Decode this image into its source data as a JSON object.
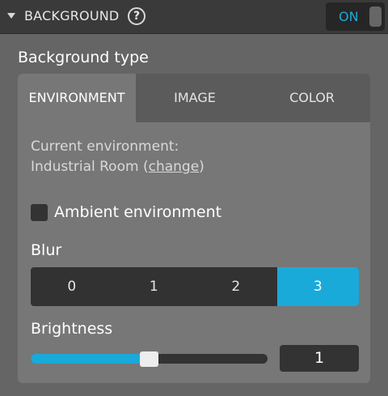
{
  "header": {
    "title": "BACKGROUND",
    "help_glyph": "?",
    "toggle_label": "ON",
    "toggle_on": true
  },
  "section_title": "Background type",
  "tabs": [
    {
      "label": "ENVIRONMENT",
      "active": true
    },
    {
      "label": "IMAGE",
      "active": false
    },
    {
      "label": "COLOR",
      "active": false
    }
  ],
  "environment": {
    "current_label": "Current environment:",
    "name": "Industrial Room",
    "open_paren": " (",
    "change_link": "change",
    "close_paren": ")"
  },
  "ambient": {
    "label": "Ambient environment",
    "checked": false
  },
  "blur": {
    "label": "Blur",
    "options": [
      "0",
      "1",
      "2",
      "3"
    ],
    "selected": "3"
  },
  "brightness": {
    "label": "Brightness",
    "value": "1",
    "slider_fraction": 0.5
  },
  "colors": {
    "accent": "#1aaad9",
    "toggle_text": "#20a8d8",
    "page_bg": "#656565",
    "panel_bg": "#777777",
    "header_bg": "#3a3a3a"
  },
  "icons": {
    "caret": "caret-down-icon",
    "help": "help-icon"
  }
}
